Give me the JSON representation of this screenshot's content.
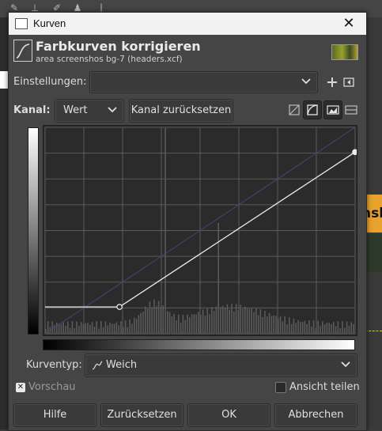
{
  "window": {
    "title": "Kurven",
    "close_glyph": "✕"
  },
  "header": {
    "title": "Farbkurven korrigieren",
    "subtitle": "area screenshos bg-7 (headers.xcf)"
  },
  "settings": {
    "label": "Einstellungen:",
    "value": "",
    "add_icon": "plus-icon",
    "menu_icon": "preset-menu-icon"
  },
  "channel": {
    "label": "Kanal:",
    "value": "Wert",
    "reset_label": "Kanal zurücksetzen"
  },
  "curve": {
    "type": "Weich",
    "points": [
      [
        0,
        0.13
      ],
      [
        0.24,
        0.13
      ],
      [
        1,
        0.88
      ]
    ],
    "grid": true
  },
  "curve_type": {
    "label": "Kurventyp:",
    "value": "Weich"
  },
  "preview": {
    "label": "Vorschau",
    "checked": true
  },
  "split_view": {
    "label": "Ansicht teilen",
    "checked": false
  },
  "buttons": {
    "help": "Hilfe",
    "reset": "Zurücksetzen",
    "ok": "OK",
    "cancel": "Abbrechen"
  },
  "background": {
    "orange_text": "nsh"
  },
  "colors": {
    "accent": "#e8a32e",
    "dialog_bg": "#454545",
    "graph_bg": "#2b2b2b"
  }
}
